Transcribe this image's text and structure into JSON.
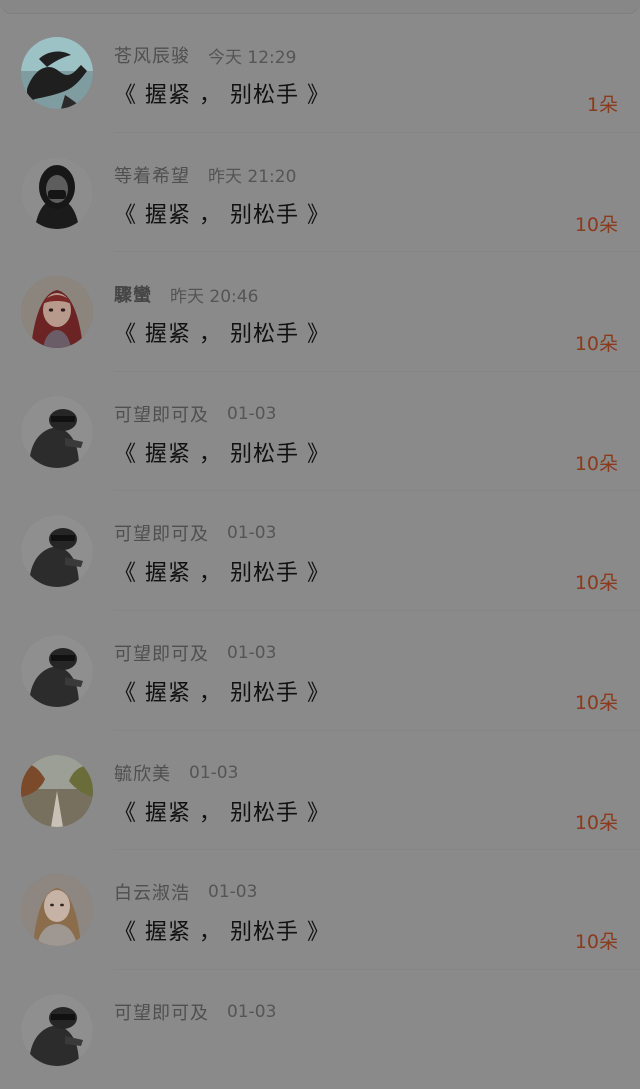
{
  "colors": {
    "background": "#8a8a8a",
    "username": "#4f4f4f",
    "time": "#555555",
    "message": "#111111",
    "count": "#8a3a1d"
  },
  "items": [
    {
      "username": "苍风辰骏",
      "time": "今天 12:29",
      "message": "《 握紧 ， 别松手 》",
      "count": "1朵",
      "avatar": "anime-silhouette-avatar"
    },
    {
      "username": "等着希望",
      "time": "昨天 21:20",
      "message": "《 握紧 ， 别松手 》",
      "count": "10朵",
      "avatar": "masked-girl-avatar"
    },
    {
      "username": "驟蠻",
      "time": "昨天 20:46",
      "message": "《 握紧 ， 别松手 》",
      "count": "10朵",
      "avatar": "red-hair-girl-avatar"
    },
    {
      "username": "可望即可及",
      "time": "01-03",
      "message": "《 握紧 ， 别松手 》",
      "count": "10朵",
      "avatar": "helmet-figure-avatar"
    },
    {
      "username": "可望即可及",
      "time": "01-03",
      "message": "《 握紧 ， 别松手 》",
      "count": "10朵",
      "avatar": "helmet-figure-avatar"
    },
    {
      "username": "可望即可及",
      "time": "01-03",
      "message": "《 握紧 ， 别松手 》",
      "count": "10朵",
      "avatar": "helmet-figure-avatar"
    },
    {
      "username": "毓欣美",
      "time": "01-03",
      "message": "《 握紧 ， 别松手 》",
      "count": "10朵",
      "avatar": "autumn-road-avatar"
    },
    {
      "username": "白云淑浩",
      "time": "01-03",
      "message": "《 握紧 ， 别松手 》",
      "count": "10朵",
      "avatar": "blonde-woman-avatar"
    },
    {
      "username": "可望即可及",
      "time": "01-03",
      "message": "",
      "count": "",
      "avatar": "helmet-figure-avatar"
    }
  ]
}
